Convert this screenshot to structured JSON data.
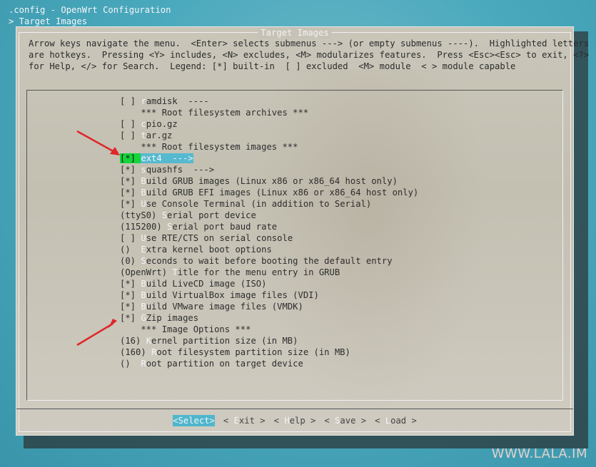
{
  "terminal": {
    "title_line1": ".config - OpenWrt Configuration",
    "title_line2": "> Target Images"
  },
  "dialog": {
    "title": "Target Images",
    "help_lines": [
      "Arrow keys navigate the menu.  <Enter> selects submenus ---> (or empty submenus ----).  Highlighted letters",
      "are hotkeys.  Pressing <Y> includes, <N> excludes, <M> modularizes features.  Press <Esc><Esc> to exit, <?>",
      "for Help, </> for Search.  Legend: [*] built-in  [ ] excluded  <M> module  < > module capable"
    ]
  },
  "menu": {
    "items": [
      {
        "pre": "[ ] ",
        "hk": "r",
        "rest": "amdisk  ----"
      },
      {
        "pre": "    *** Root filesystem archives ***",
        "hk": "",
        "rest": ""
      },
      {
        "pre": "[ ] ",
        "hk": "c",
        "rest": "pio.gz"
      },
      {
        "pre": "[ ] ",
        "hk": "t",
        "rest": "ar.gz"
      },
      {
        "pre": "    *** Root filesystem images ***",
        "hk": "",
        "rest": ""
      },
      {
        "pre": "[*] ",
        "hk": "e",
        "rest": "xt4  --->"
      },
      {
        "pre": "[*] ",
        "hk": "s",
        "rest": "quashfs  --->"
      },
      {
        "pre": "[*] ",
        "hk": "B",
        "rest": "uild GRUB images (Linux x86 or x86_64 host only)"
      },
      {
        "pre": "[*] ",
        "hk": "B",
        "rest": "uild GRUB EFI images (Linux x86 or x86_64 host only)"
      },
      {
        "pre": "[*] ",
        "hk": "U",
        "rest": "se Console Terminal (in addition to Serial)"
      },
      {
        "pre": "(ttyS0) ",
        "hk": "S",
        "rest": "erial port device"
      },
      {
        "pre": "(115200) ",
        "hk": "S",
        "rest": "erial port baud rate"
      },
      {
        "pre": "[ ] ",
        "hk": "U",
        "rest": "se RTE/CTS on serial console"
      },
      {
        "pre": "()  ",
        "hk": "E",
        "rest": "xtra kernel boot options"
      },
      {
        "pre": "(0) ",
        "hk": "S",
        "rest": "econds to wait before booting the default entry"
      },
      {
        "pre": "(OpenWrt) ",
        "hk": "T",
        "rest": "itle for the menu entry in GRUB"
      },
      {
        "pre": "[*] ",
        "hk": "B",
        "rest": "uild LiveCD image (ISO)"
      },
      {
        "pre": "[*] ",
        "hk": "B",
        "rest": "uild VirtualBox image files (VDI)"
      },
      {
        "pre": "[*] ",
        "hk": "B",
        "rest": "uild VMware image files (VMDK)"
      },
      {
        "pre": "[*] ",
        "hk": "G",
        "rest": "Zip images"
      },
      {
        "pre": "    *** Image Options ***",
        "hk": "",
        "rest": ""
      },
      {
        "pre": "(16) ",
        "hk": "K",
        "rest": "ernel partition size (in MB)"
      },
      {
        "pre": "(160) ",
        "hk": "R",
        "rest": "oot filesystem partition size (in MB)"
      },
      {
        "pre": "()  ",
        "hk": "R",
        "rest": "oot partition on target device"
      }
    ],
    "selected_index": 5
  },
  "buttons": [
    {
      "l": "<",
      "hk": "S",
      "rest": "elect",
      "r": ">",
      "active": true
    },
    {
      "l": "< ",
      "hk": "E",
      "rest": "xit",
      "r": " >",
      "active": false
    },
    {
      "l": "< ",
      "hk": "H",
      "rest": "elp",
      "r": " >",
      "active": false
    },
    {
      "l": "< ",
      "hk": "S",
      "rest": "ave",
      "r": " >",
      "active": false
    },
    {
      "l": "< ",
      "hk": "L",
      "rest": "oad",
      "r": " >",
      "active": false
    }
  ],
  "watermark": "WWW.LALA.IM",
  "colors": {
    "terminal_bg": "#4aa9bd",
    "dialog_bg": "#c6c3b6",
    "highlight": "#55b9d0",
    "flag_green": "#14d43a",
    "arrow_red": "#e0262a"
  }
}
